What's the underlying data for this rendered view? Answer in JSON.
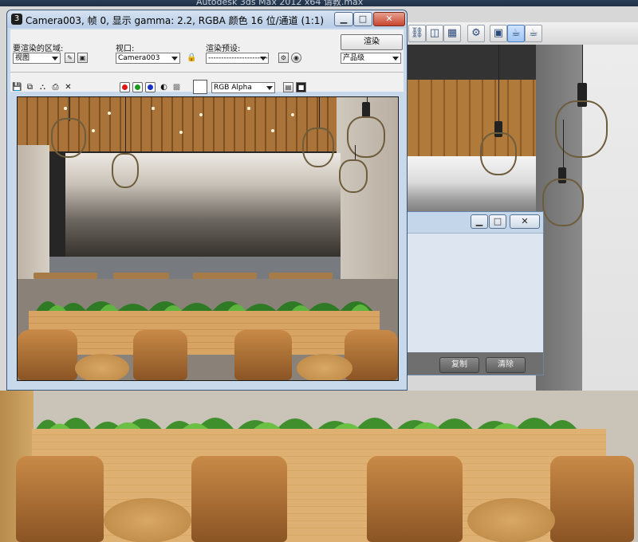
{
  "app": {
    "title": "Autodesk 3ds Max  2012 x64    请教.max"
  },
  "render_frame": {
    "title": "Camera003, 帧 0, 显示 gamma: 2.2, RGBA 颜色 16 位/通道 (1:1)",
    "area_label": "要渲染的区域:",
    "area_value": "视图",
    "viewport_label": "视口:",
    "viewport_value": "Camera003",
    "preset_label": "渲染预设:",
    "preset_value": "-------------------------",
    "render_button": "渲染",
    "quality_value": "产品级",
    "channel_value": "RGB Alpha",
    "window_buttons": {
      "minimize": "▁",
      "maximize": "□",
      "close": "✕"
    }
  },
  "small_dialog": {
    "copy_button": "复制",
    "clear_button": "清除",
    "window_buttons": {
      "minimize": "▁",
      "maximize": "□",
      "close": "✕"
    }
  },
  "toolbar_icons": [
    "select-and-link-icon",
    "graph-editor-icon",
    "material-editor-icon",
    "render-setup-icon",
    "rendered-frame-window-icon",
    "render-production-icon",
    "teapot-render-icon"
  ],
  "colors": {
    "accent": "#b8cde6",
    "close_red": "#c7462f",
    "red_channel": "#e01414",
    "green_channel": "#1a9a1a",
    "blue_channel": "#1430c8"
  }
}
